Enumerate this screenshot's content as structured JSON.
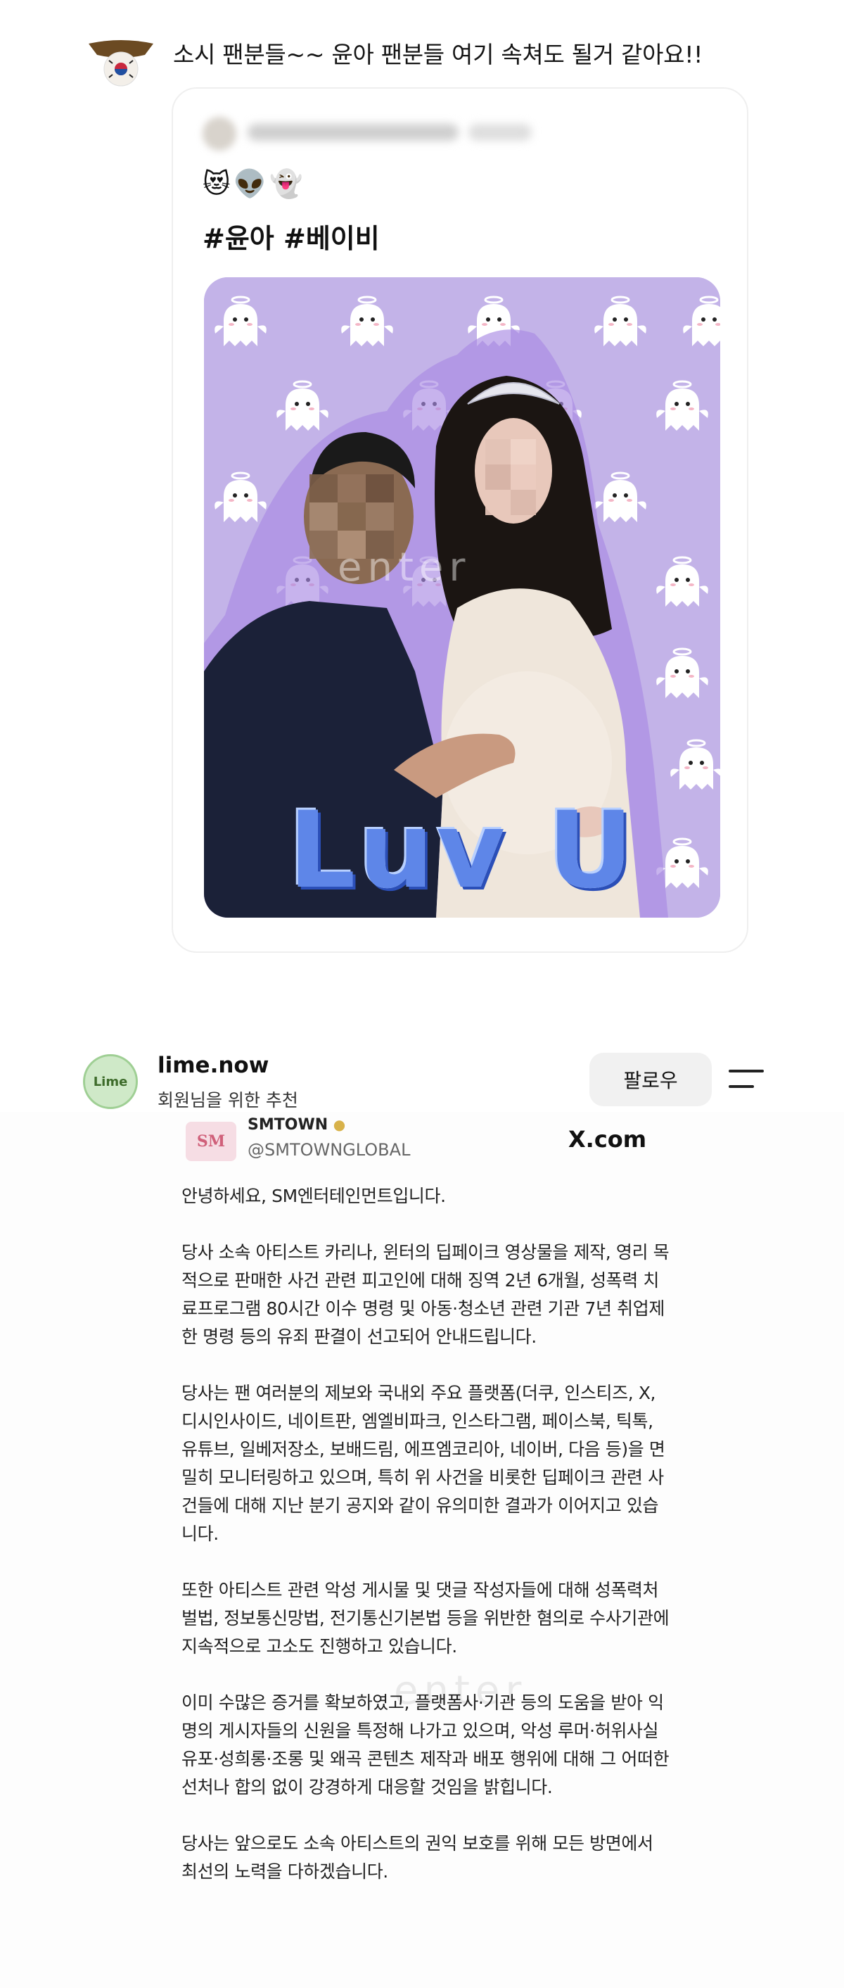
{
  "comment": {
    "text": "소시 팬분들~~ 윤아 팬분들 여기 속쳐도 될거 같아요!!"
  },
  "quoted_post": {
    "emojis": [
      "😻",
      "👽",
      "👻"
    ],
    "hashtags": "#윤아 #베이비",
    "image": {
      "watermark": "enter",
      "sticker_text": "Luv U"
    }
  },
  "post": {
    "author": "lime.now",
    "subtitle": "회원님을 위한 추천",
    "follow_label": "팔로우",
    "avatar_label": "Lime",
    "embedded": {
      "logo_text": "SM",
      "account_name": "SMTOWN",
      "handle": "@SMTOWNGLOBAL",
      "source": "X.com",
      "watermark": "enter",
      "paragraphs": [
        "안녕하세요, SM엔터테인먼트입니다.",
        "당사 소속 아티스트 카리나, 윈터의 딥페이크 영상물을 제작, 영리 목적으로 판매한 사건 관련 피고인에 대해 징역 2년 6개월, 성폭력 치료프로그램 80시간 이수 명령 및 아동·청소년 관련 기관 7년 취업제한 명령 등의 유죄 판결이 선고되어 안내드립니다.",
        "당사는 팬 여러분의 제보와 국내외 주요 플랫폼(더쿠, 인스티즈, X, 디시인사이드, 네이트판, 엠엘비파크, 인스타그램, 페이스북, 틱톡, 유튜브, 일베저장소, 보배드림, 에프엠코리아, 네이버, 다음 등)을 면밀히 모니터링하고 있으며, 특히 위 사건을 비롯한 딥페이크 관련 사건들에 대해 지난 분기 공지와 같이 유의미한 결과가 이어지고 있습니다.",
        "또한 아티스트 관련 악성 게시물 및 댓글 작성자들에 대해 성폭력처벌법, 정보통신망법, 전기통신기본법 등을 위반한 혐의로 수사기관에 지속적으로 고소도 진행하고 있습니다.",
        "이미 수많은 증거를 확보하였고, 플랫폼사·기관 등의 도움을 받아 익명의 게시자들의 신원을 특정해 나가고 있으며, 악성 루머·허위사실 유포·성희롱·조롱 및 왜곡 콘텐츠 제작과 배포 행위에 대해 그 어떠한 선처나 합의 없이 강경하게 대응할 것임을 밝힙니다.",
        "당사는 앞으로도 소속 아티스트의 권익 보호를 위해 모든 방면에서 최선의 노력을 다하겠습니다."
      ]
    }
  },
  "icons": [
    "korea-flag-avatar",
    "menu-icon",
    "verified-badge-icon",
    "ghost-pattern"
  ],
  "colors": {
    "image_background": "#c3b3e8",
    "sticker_blue": "#5e86e8",
    "follow_button_bg": "#f1f1f1"
  }
}
